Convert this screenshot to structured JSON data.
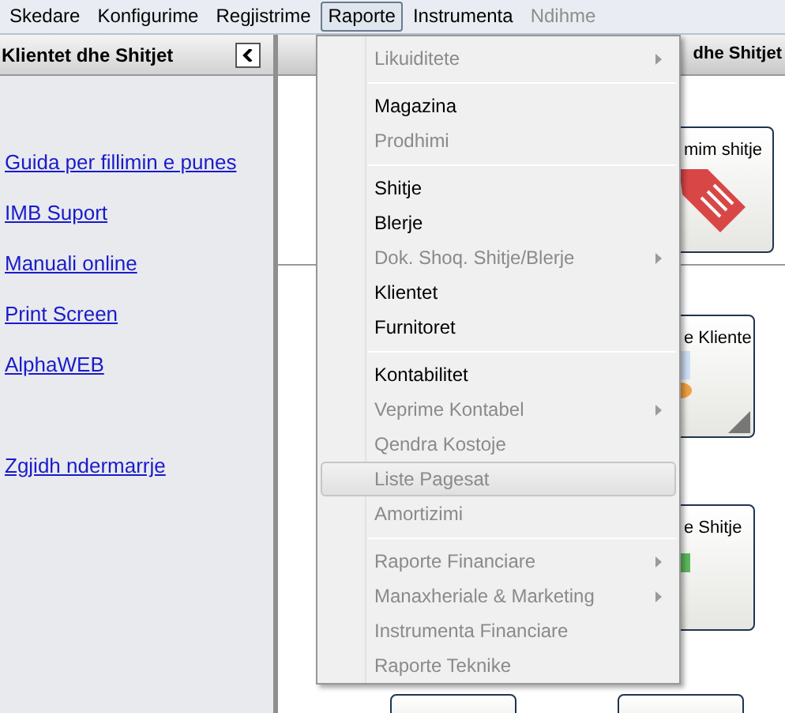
{
  "menubar": [
    {
      "label": "Skedare",
      "selected": false,
      "disabled": false
    },
    {
      "label": "Konfigurime",
      "selected": false,
      "disabled": false
    },
    {
      "label": "Regjistrime",
      "selected": false,
      "disabled": false
    },
    {
      "label": "Raporte",
      "selected": true,
      "disabled": false
    },
    {
      "label": "Instrumenta",
      "selected": false,
      "disabled": false
    },
    {
      "label": "Ndihme",
      "selected": false,
      "disabled": true
    }
  ],
  "sidebar": {
    "title": "Klientet dhe Shitjet",
    "links": [
      "Guida per fillimin e punes",
      "IMB Suport",
      "Manuali online",
      "Print Screen",
      "AlphaWEB"
    ],
    "bottom_links": [
      "Zgjidh ndermarrje"
    ]
  },
  "main": {
    "title": "dhe Shitjet",
    "tiles": [
      {
        "label": "mim shitje",
        "kind": "tag"
      },
      {
        "label": "e Kliente",
        "kind": "clients"
      },
      {
        "label": "e Shitje",
        "kind": "chart"
      },
      {
        "kind": "blank"
      },
      {
        "kind": "blank"
      }
    ]
  },
  "menu": [
    {
      "kind": "item",
      "label": "Likuiditete",
      "disabled": true,
      "submenu": true,
      "selected": false
    },
    {
      "kind": "separator"
    },
    {
      "kind": "item",
      "label": "Magazina",
      "disabled": false,
      "submenu": false,
      "selected": false
    },
    {
      "kind": "item",
      "label": "Prodhimi",
      "disabled": true,
      "submenu": false,
      "selected": false
    },
    {
      "kind": "separator"
    },
    {
      "kind": "item",
      "label": "Shitje",
      "disabled": false,
      "submenu": false,
      "selected": false
    },
    {
      "kind": "item",
      "label": "Blerje",
      "disabled": false,
      "submenu": false,
      "selected": false
    },
    {
      "kind": "item",
      "label": "Dok. Shoq. Shitje/Blerje",
      "disabled": true,
      "submenu": true,
      "selected": false
    },
    {
      "kind": "item",
      "label": "Klientet",
      "disabled": false,
      "submenu": false,
      "selected": false
    },
    {
      "kind": "item",
      "label": "Furnitoret",
      "disabled": false,
      "submenu": false,
      "selected": false
    },
    {
      "kind": "separator"
    },
    {
      "kind": "item",
      "label": "Kontabilitet",
      "disabled": false,
      "submenu": false,
      "selected": false
    },
    {
      "kind": "item",
      "label": "Veprime Kontabel",
      "disabled": true,
      "submenu": true,
      "selected": false
    },
    {
      "kind": "item",
      "label": "Qendra Kostoje",
      "disabled": true,
      "submenu": false,
      "selected": false
    },
    {
      "kind": "item",
      "label": "Liste Pagesat",
      "disabled": true,
      "submenu": false,
      "selected": true
    },
    {
      "kind": "item",
      "label": "Amortizimi",
      "disabled": true,
      "submenu": false,
      "selected": false
    },
    {
      "kind": "separator"
    },
    {
      "kind": "item",
      "label": "Raporte Financiare",
      "disabled": true,
      "submenu": true,
      "selected": false
    },
    {
      "kind": "item",
      "label": "Manaxheriale & Marketing",
      "disabled": true,
      "submenu": true,
      "selected": false
    },
    {
      "kind": "item",
      "label": "Instrumenta Financiare",
      "disabled": true,
      "submenu": false,
      "selected": false
    },
    {
      "kind": "item",
      "label": "Raporte Teknike",
      "disabled": true,
      "submenu": false,
      "selected": false
    }
  ]
}
